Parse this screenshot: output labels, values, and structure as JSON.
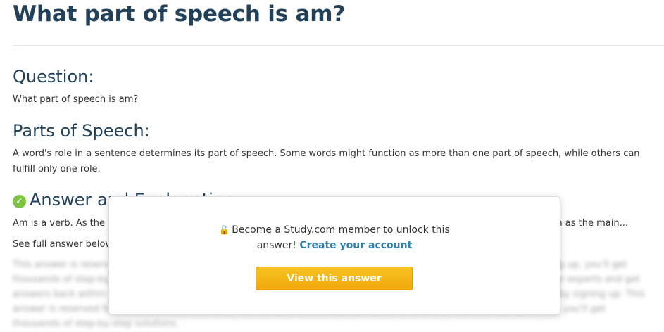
{
  "page": {
    "title": "What part of speech is am?"
  },
  "question": {
    "heading": "Question:",
    "text": "What part of speech is am?"
  },
  "parts_of_speech": {
    "heading": "Parts of Speech:",
    "text": "A word's role in a sentence determines its part of speech. Some words might function as more than one part of speech, while others can fulfill only one role."
  },
  "answer": {
    "heading": "Answer and Explanation",
    "icon": "check-circle-icon",
    "icon_color": "#7cc243",
    "intro_start": "Am is a verb. As the m",
    "intro_end": "am as the main...",
    "see_full": "See full answer below",
    "blurred_text": "This answer is reserved for Study.com members only. You can gain access by signing up for a 5-day free trial. By signing up, you'll get thousands of step-by-step solutions to your homework questions. You can also ask your own homework questions to our experts and get answers back within hours. Access all of these answers easily on all major devices. You can gain access to this answer by signing up. This answer is reserved for Study.com members only. You can gain access by signing up for a 5-day free trial. By signing up, you'll get thousands of step-by-step solutions."
  },
  "modal": {
    "lock_icon": "lock-open-icon",
    "message_line1": "Become a Study.com member to unlock this",
    "message_line2": "answer!",
    "link_label": "Create your account",
    "button_label": "View this answer",
    "link_color": "#2f7fa8",
    "button_color": "#f2b313"
  }
}
